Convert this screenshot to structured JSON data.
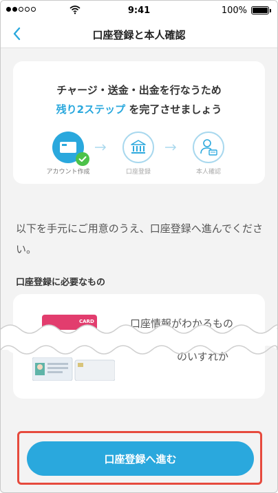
{
  "status_bar": {
    "time": "9:41",
    "battery_text": "100%",
    "signal_bars_filled": 5
  },
  "navbar": {
    "title": "口座登録と本人確認"
  },
  "progress_card": {
    "headline_line1": "チャージ・送金・出金を行なうため",
    "headline_accent": "残り2ステップ",
    "headline_line2_rest": " を完了させましょう",
    "steps": [
      {
        "label": "アカウント作成",
        "state": "done"
      },
      {
        "label": "口座登録",
        "state": "pending"
      },
      {
        "label": "本人確認",
        "state": "pending"
      }
    ]
  },
  "intro_text": "以下を手元にご用意のうえ、口座登録へ進んでください。",
  "requirements": {
    "title": "口座登録に必要なもの",
    "item1_text": "口座情報がわかるもの",
    "item2_text": "のいずれか",
    "card_brand_text": "CARD"
  },
  "cta": {
    "label": "口座登録へ進む"
  },
  "colors": {
    "accent": "#2aa8dd",
    "check": "#4cc24a",
    "highlight_border": "#e64a3d"
  }
}
